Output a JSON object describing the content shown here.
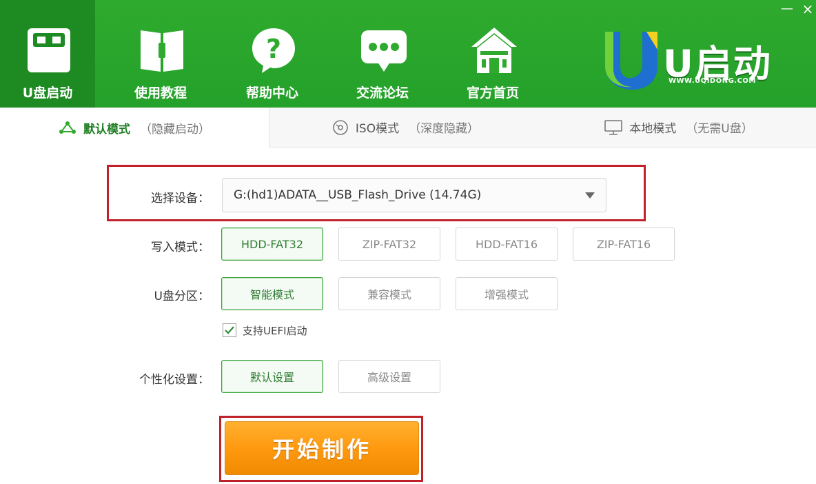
{
  "window": {
    "minimize_label": "—",
    "close_label": "×"
  },
  "nav": {
    "items": [
      {
        "label": "U盘启动",
        "icon": "usb-drive-icon",
        "active": true
      },
      {
        "label": "使用教程",
        "icon": "book-icon",
        "active": false
      },
      {
        "label": "帮助中心",
        "icon": "help-question-icon",
        "active": false
      },
      {
        "label": "交流论坛",
        "icon": "chat-bubble-icon",
        "active": false
      },
      {
        "label": "官方首页",
        "icon": "home-icon",
        "active": false
      }
    ]
  },
  "logo": {
    "text": "U启动",
    "url": "WWW.UQIDONG.COM"
  },
  "modes": {
    "default": {
      "name": "默认模式",
      "sub": "（隐藏启动）",
      "icon": "network-icon"
    },
    "iso": {
      "name": "ISO模式",
      "sub": "（深度隐藏）",
      "icon": "disc-icon"
    },
    "local": {
      "name": "本地模式",
      "sub": "（无需U盘）",
      "icon": "monitor-icon"
    }
  },
  "form": {
    "device_label": "选择设备：",
    "device_value": "G:(hd1)ADATA__USB_Flash_Drive (14.74G)",
    "write_mode_label": "写入模式：",
    "write_modes": [
      "HDD-FAT32",
      "ZIP-FAT32",
      "HDD-FAT16",
      "ZIP-FAT16"
    ],
    "write_mode_selected": "HDD-FAT32",
    "partition_label": "U盘分区：",
    "partitions": [
      "智能模式",
      "兼容模式",
      "增强模式"
    ],
    "partition_selected": "智能模式",
    "uefi_label": "支持UEFI启动",
    "uefi_checked": true,
    "personalize_label": "个性化设置：",
    "personalize_options": [
      "默认设置",
      "高级设置"
    ],
    "personalize_selected": "默认设置",
    "start_label": "开始制作"
  },
  "colors": {
    "header_green": "#2faa2e",
    "active_nav": "#1e8a22",
    "selected_border": "#3aa43c",
    "highlight_red": "#c0202a",
    "start_orange": "#ff9a10"
  }
}
